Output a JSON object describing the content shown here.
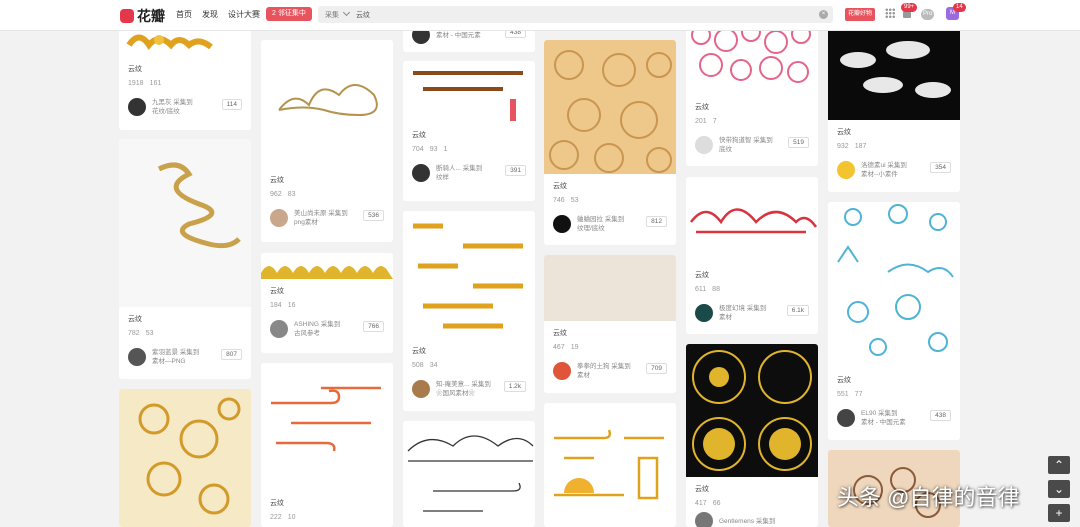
{
  "header": {
    "logo": "花瓣",
    "nav": [
      "首页",
      "发现",
      "设计大赛"
    ],
    "promo": "2 邻征集中",
    "search": {
      "category": "采集",
      "query": "云纹"
    },
    "upload_label": "花瓣好物",
    "notification_badge": "99+",
    "pro_label": "Pro",
    "avatar_badge": "14"
  },
  "cards": [
    {
      "title": "云纹",
      "saves": "1918",
      "likes": "161",
      "owner": "九黑灰 采集到",
      "board": "花纹/底纹",
      "count": "114"
    },
    {
      "title": "云纹",
      "saves": "782",
      "likes": "53",
      "owner": "紫羽蓝景 采集到",
      "board": "素材—PNG",
      "count": "807"
    },
    {
      "title": "云纹",
      "saves": "962",
      "likes": "83",
      "owner": "美山尚未原 采集到",
      "board": "png素材",
      "count": "536"
    },
    {
      "title": "云纹",
      "saves": "184",
      "likes": "16",
      "owner": "ASHING 采集到",
      "board": "古风参考",
      "count": "766"
    },
    {
      "title": "云纹",
      "saves": "222",
      "likes": "10",
      "owner": "",
      "board": "",
      "count": ""
    },
    {
      "title": "",
      "saves": "",
      "likes": "",
      "owner": "",
      "board": "素材 - 中国元素",
      "count": "438"
    },
    {
      "title": "云纹",
      "saves": "704",
      "likes": "93",
      "comments": "1",
      "owner": "断骑人... 采集到",
      "board": "纹样",
      "count": "391"
    },
    {
      "title": "云纹",
      "saves": "508",
      "likes": "34",
      "owner": "知-庵美意... 采集到",
      "board": "❀国风素材❀",
      "count": "1.2k"
    },
    {
      "title": "云纹",
      "saves": "746",
      "likes": "53",
      "owner": "蛐蛐园拉 采集到",
      "board": "纹理/底纹",
      "count": "812"
    },
    {
      "title": "云纹",
      "saves": "467",
      "likes": "19",
      "owner": "拳拳的土狗 采集到",
      "board": "素材",
      "count": "709"
    },
    {
      "title": "云纹",
      "saves": "201",
      "likes": "7",
      "owner": "快带狗道智 采集到",
      "board": "底纹",
      "count": "519"
    },
    {
      "title": "云纹",
      "saves": "611",
      "likes": "88",
      "owner": "极度幻境 采集到",
      "board": "素材",
      "count": "6.1k"
    },
    {
      "title": "云纹",
      "saves": "417",
      "likes": "66",
      "owner": "Gentlemens 采集到",
      "board": "",
      "count": ""
    },
    {
      "title": "云纹",
      "saves": "932",
      "likes": "187",
      "owner": "洛德素ui 采集到",
      "board": "素材--小素件",
      "count": "354"
    },
    {
      "title": "云纹",
      "saves": "551",
      "likes": "77",
      "owner": "EL90 采集到",
      "board": "素材 - 中国元素",
      "count": "438"
    }
  ],
  "watermark": "头条 @自律的音律",
  "colors": {
    "accent": "#e8545e",
    "gold": "#e0a21d",
    "red": "#d9333f",
    "pink": "#e5648a",
    "teal": "#4fb3d6"
  }
}
